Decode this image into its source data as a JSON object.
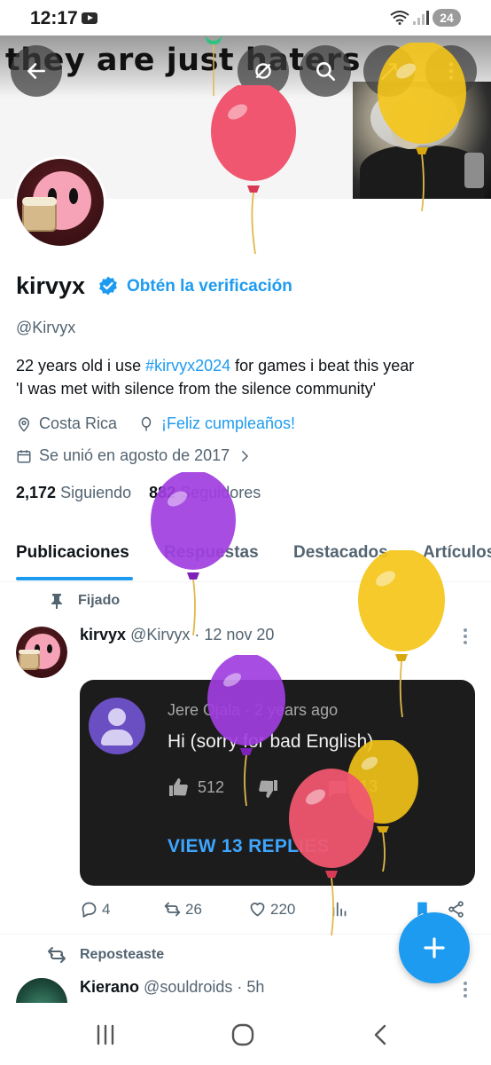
{
  "status_bar": {
    "time": "12:17",
    "battery": "24"
  },
  "banner": {
    "text": "they are just haters"
  },
  "profile": {
    "name": "kirvyx",
    "get_verified": "Obtén la verificación",
    "handle": "@Kirvyx",
    "bio_line1_pre": "22 years old i use ",
    "bio_hashtag": "#kirvyx2024",
    "bio_line1_post": " for games i beat this year",
    "bio_line2": "'I was met with silence from the silence community'",
    "location": "Costa Rica",
    "birthday": "¡Feliz cumpleaños!",
    "joined": "Se unió en agosto de 2017",
    "following_count": "2,172",
    "following_label": "Siguiendo",
    "followers_count": "882",
    "followers_label": "Seguidores"
  },
  "tabs": [
    {
      "label": "Publicaciones"
    },
    {
      "label": "Respuestas"
    },
    {
      "label": "Destacados"
    },
    {
      "label": "Artículos"
    }
  ],
  "pinned_post": {
    "pinned_label": "Fijado",
    "author": "kirvyx",
    "handle_date": "@Kirvyx · 12 nov 20",
    "embed": {
      "author_meta": "Jere Ojala · 2 years ago",
      "text": "Hi (sorry for bad English)",
      "likes": "512",
      "replies": "13",
      "view_replies": "VIEW 13 REPLIES"
    },
    "replies": "4",
    "reposts": "26",
    "likes": "220"
  },
  "repost": {
    "label": "Reposteaste",
    "author": "Kierano",
    "handle_time": "@souldroids · 5h"
  },
  "colors": {
    "accent": "#1d9bf0",
    "text": "#0f1419",
    "secondary": "#536471",
    "embed_bg": "#1c1c1c",
    "yt_link": "#3ea6ff"
  },
  "icons": {
    "back": "arrow-left-icon",
    "hide": "eye-off-icon",
    "search": "search-icon",
    "share": "share-icon",
    "more": "more-vertical-icon",
    "verified": "verified-badge-icon",
    "location": "location-pin-icon",
    "balloon": "balloon-icon",
    "calendar": "calendar-icon",
    "chevron": "chevron-right-icon",
    "pin": "pin-icon",
    "reply": "reply-icon",
    "repost": "repost-icon",
    "like": "heart-icon",
    "views": "analytics-icon",
    "bookmark": "bookmark-icon",
    "compose": "plus-icon"
  }
}
